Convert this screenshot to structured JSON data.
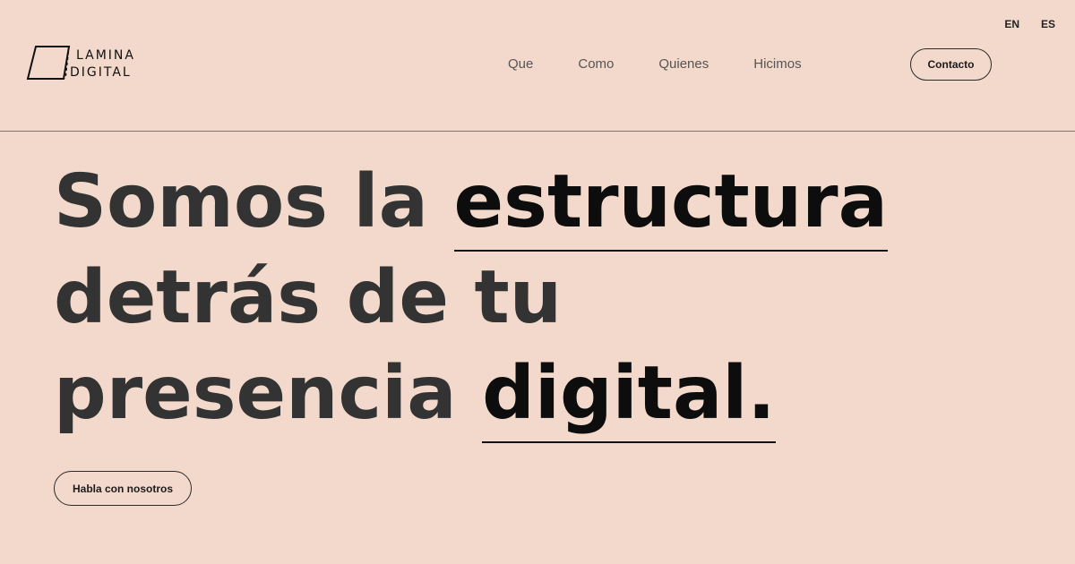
{
  "languages": [
    "EN",
    "ES"
  ],
  "logo": {
    "line1": "LAMINA",
    "line2": "DIGITAL"
  },
  "nav": {
    "items": [
      "Que",
      "Como",
      "Quienes",
      "Hicimos"
    ]
  },
  "header": {
    "contact_label": "Contacto"
  },
  "hero": {
    "line1_start": "Somos la ",
    "line1_highlight": "estructura",
    "line2": "detrás de tu",
    "line3_start": "presencia ",
    "line3_highlight": "digital."
  },
  "cta": {
    "label": "Habla con nosotros"
  },
  "colors": {
    "background": "#f2d9cb",
    "text": "#333333",
    "highlight": "#0d0d0d",
    "border": "#2b2b2b"
  }
}
